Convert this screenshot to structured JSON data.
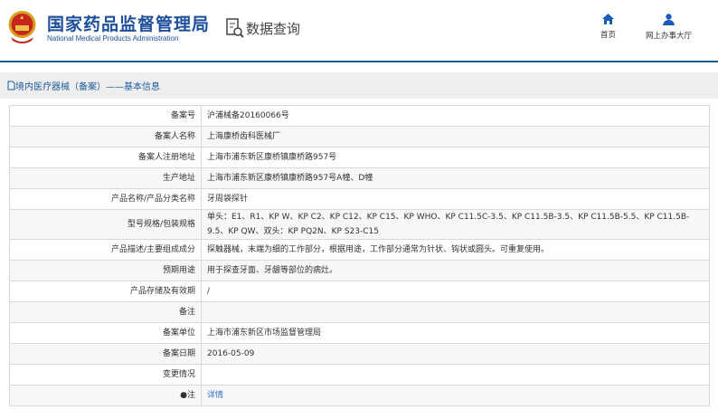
{
  "header": {
    "title_cn": "国家药品监督管理局",
    "title_en": "National Medical Products Administration",
    "section": "数据查询",
    "nav": [
      {
        "label": "首页",
        "icon": "home-icon"
      },
      {
        "label": "网上办事大厅",
        "icon": "user-icon"
      }
    ]
  },
  "breadcrumb": "境内医疗器械（备案）——基本信息",
  "rows": [
    {
      "label": "备案号",
      "value": "沪浦械备20160066号"
    },
    {
      "label": "备案人名称",
      "value": "上海康桥齿科医械厂"
    },
    {
      "label": "备案人注册地址",
      "value": "上海市浦东新区康桥镇康桥路957号"
    },
    {
      "label": "生产地址",
      "value": "上海市浦东新区康桥镇康桥路957号A幢、D幢"
    },
    {
      "label": "产品名称/产品分类名称",
      "value": "牙周袋探针"
    },
    {
      "label": "型号规格/包装规格",
      "value": "单头：E1、R1、KP W、KP C2、KP C12、KP C15、KP WHO、KP C11.5C-3.5、KP C11.5B-3.5、KP C11.5B-5.5、KP C11.5B-9.5、KP QW、双头：KP PQ2N、KP S23-C15"
    },
    {
      "label": "产品描述/主要组成成分",
      "value": "探触器械，末端为细的工作部分，根据用途，工作部分通常为针状、钩状或圆头。可重复使用。"
    },
    {
      "label": "预期用途",
      "value": "用于探查牙面、牙龈等部位的病灶。"
    },
    {
      "label": "产品存储及有效期",
      "value": "/"
    },
    {
      "label": "备注",
      "value": ""
    },
    {
      "label": "备案单位",
      "value": "上海市浦东新区市场监督管理局"
    },
    {
      "label": "备案日期",
      "value": "2016-05-09"
    },
    {
      "label": "变更情况",
      "value": ""
    },
    {
      "label": "●注",
      "value": "详情",
      "link": true
    }
  ]
}
